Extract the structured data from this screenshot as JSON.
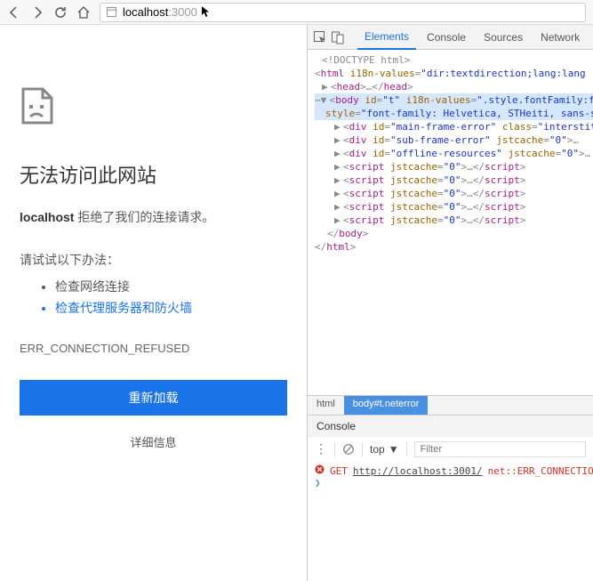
{
  "url": {
    "host": "localhost",
    "port": ":3000"
  },
  "error": {
    "title": "无法访问此网站",
    "sub_bold": "localhost",
    "sub_rest": " 拒绝了我们的连接请求。",
    "try_label": "请试试以下办法：",
    "suggestions": [
      "检查网络连接",
      "检查代理服务器和防火墙"
    ],
    "code": "ERR_CONNECTION_REFUSED",
    "reload": "重新加载",
    "details": "详细信息"
  },
  "devtools_tabs": {
    "elements": "Elements",
    "console": "Console",
    "sources": "Sources",
    "network": "Network"
  },
  "dom": {
    "doctype": "<!DOCTYPE html>",
    "html_open": "html",
    "html_attr": "i18n-values",
    "html_val": "\"dir:textdirection;lang:lang",
    "head": "head",
    "body": "body",
    "body_id_attr": "id",
    "body_id_val": "\"t\"",
    "body_i18n_attr": "i18n-values",
    "body_i18n_val": "\".style.fontFamily:f",
    "style_attr": "style",
    "style_val": "\"font-family: Helvetica, STHeiti, sans-s",
    "div": "div",
    "id_attr": "id",
    "mfe": "\"main-frame-error\"",
    "class_attr": "class",
    "inter": "\"interstiti",
    "sfe": "\"sub-frame-error\"",
    "jst_attr": "jstcache",
    "jst0": "\"0\"",
    "off": "\"offline-resources\"",
    "script": "script",
    "end_body": "body",
    "end_html": "html"
  },
  "breadcrumb": {
    "html": "html",
    "body": "body#t.neterror"
  },
  "console": {
    "tab": "Console",
    "top": "top",
    "filter_ph": "Filter",
    "method": "GET",
    "url": "http://localhost:3001/",
    "err": "net::ERR_CONNECTIO"
  }
}
